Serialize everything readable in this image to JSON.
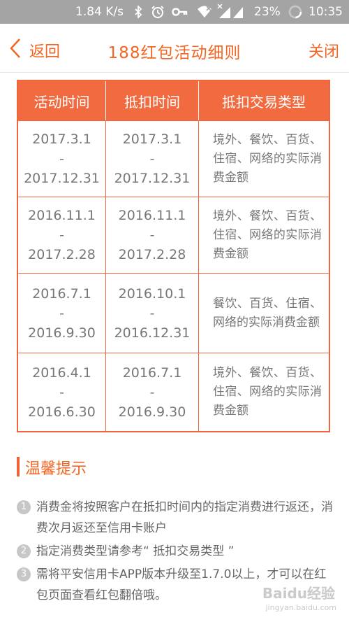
{
  "status_bar": {
    "speed": "1.84 K/s",
    "battery": "23%",
    "time": "10:35",
    "icons": [
      "bluetooth-icon",
      "alarm-icon",
      "key-icon",
      "wifi-icon",
      "signal-icon",
      "battery-icon"
    ]
  },
  "nav": {
    "back_label": "返回",
    "title": "188红包活动细则",
    "close_label": "关闭"
  },
  "table": {
    "headers": [
      "活动时间",
      "抵扣时间",
      "抵扣交易类型"
    ],
    "rows": [
      {
        "activity": {
          "start": "2017.3.1",
          "sep": "-",
          "end": "2017.12.31"
        },
        "deduct": {
          "start": "2017.3.1",
          "sep": "-",
          "end": "2017.12.31"
        },
        "type": "境外、餐饮、百货、住宿、网络的实际消费金额"
      },
      {
        "activity": {
          "start": "2016.11.1",
          "sep": "-",
          "end": "2017.2.28"
        },
        "deduct": {
          "start": "2016.11.1",
          "sep": "-",
          "end": "2017.2.28"
        },
        "type": "境外、餐饮、百货、住宿、网络的实际消费金额"
      },
      {
        "activity": {
          "start": "2016.7.1",
          "sep": "-",
          "end": "2016.9.30"
        },
        "deduct": {
          "start": "2016.10.1",
          "sep": "-",
          "end": "2016.12.31"
        },
        "type": "餐饮、百货、住宿、网络的实际消费金额"
      },
      {
        "activity": {
          "start": "2016.4.1",
          "sep": "-",
          "end": "2016.6.30"
        },
        "deduct": {
          "start": "2016.7.1",
          "sep": "-",
          "end": "2016.9.30"
        },
        "type": "境外、餐饮、百货、住宿、网络的实际消费金额"
      }
    ]
  },
  "tips": {
    "title": "温馨提示",
    "items": [
      {
        "num": "1",
        "text": "消费金将按照客户在抵扣时间内的指定消费进行返还，消费次月返还至信用卡账户"
      },
      {
        "num": "2",
        "text": "指定消费类型请参考“ 抵扣交易类型 ”"
      },
      {
        "num": "3",
        "text": "需将平安信用卡APP版本升级至1.7.0以上，才可以在红包页面查看红包翻倍哦。"
      }
    ]
  },
  "watermark": {
    "text": "Baidu经验",
    "sub": "jingyan.baidu.com"
  },
  "colors": {
    "accent": "#f26522",
    "table_border": "#f0643c",
    "header_bg": "#f26b40",
    "statusbar_bg": "#a4a4a4"
  }
}
